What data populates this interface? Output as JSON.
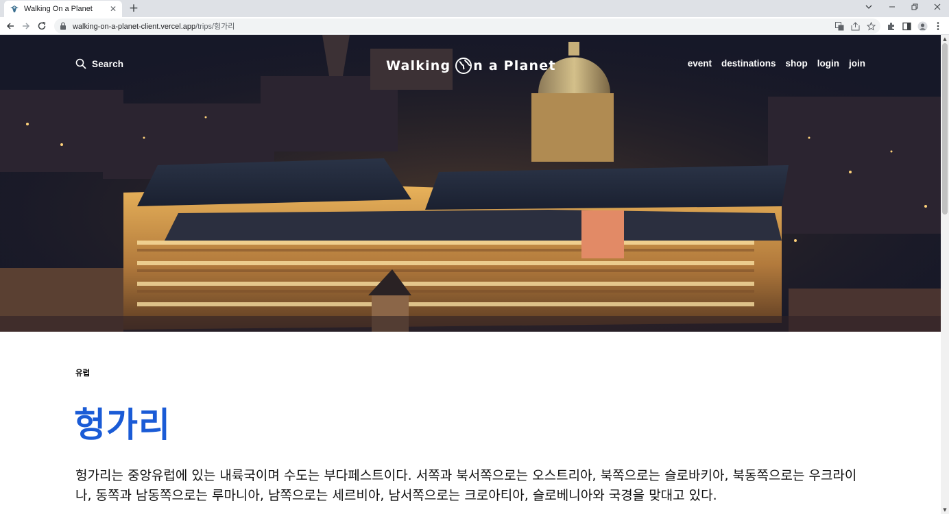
{
  "browser": {
    "tab_title": "Walking On a Planet",
    "tab_close": "✕",
    "new_tab": "+",
    "url_host": "walking-on-a-planet-client.vercel.app",
    "url_path": "/trips/헝가리"
  },
  "header": {
    "search_label": "Search",
    "logo_left": "Walking",
    "logo_right": "n a Planet",
    "menu": [
      {
        "label": "event"
      },
      {
        "label": "destinations"
      },
      {
        "label": "shop"
      },
      {
        "label": "login"
      },
      {
        "label": "join"
      }
    ]
  },
  "trip": {
    "continent": "유럽",
    "country": "헝가리",
    "description": "헝가리는 중앙유럽에 있는 내륙국이며 수도는 부다페스트이다. 서쪽과 북서쪽으로는 오스트리아, 북쪽으로는 슬로바키아, 북동쪽으로는 우크라이나, 동쪽과 남동쪽으로는 루마니아, 남쪽으로는 세르비아, 남서쪽으로는 크로아티아, 슬로베니아와 국경을 맞대고 있다."
  },
  "colors": {
    "country_title": "#1a5bd6",
    "nav_text": "#ffffff"
  }
}
